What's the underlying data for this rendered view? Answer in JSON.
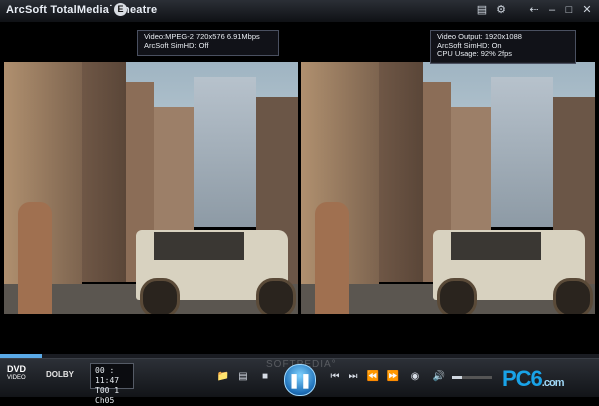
{
  "titlebar": {
    "title": "ArcSoft TotalMedia˙ Theatre",
    "badge": "E",
    "icons": [
      "briefcase-icon",
      "gear-icon",
      "pin-icon",
      "minimize-icon",
      "restore-icon",
      "close-icon"
    ]
  },
  "overlay_left": {
    "line1": "Video:MPEG-2 720x576 6.91Mbps",
    "line2": "ArcSoft SimHD: Off"
  },
  "overlay_right": {
    "line1": "Video Output: 1920x1088",
    "line2": "ArcSoft SimHD: On",
    "line3": "CPU Usage: 92% 2fps"
  },
  "status": {
    "dvd_label": "DVD",
    "dvd_sub": "VIDEO",
    "dolby_label": "DOLBY",
    "time_line1": "00 : 11:47",
    "time_line2": "T00 1  Ch05",
    "progress": 0.07
  },
  "controls": {
    "volume": 0.25
  },
  "watermark": "SOFTPEDIA°",
  "logo": {
    "main": "PC6",
    "sub": ".com"
  },
  "colors": {
    "accent": "#1e6fb8",
    "progress": "#5aa9e6",
    "logo": "#19a3e8"
  }
}
